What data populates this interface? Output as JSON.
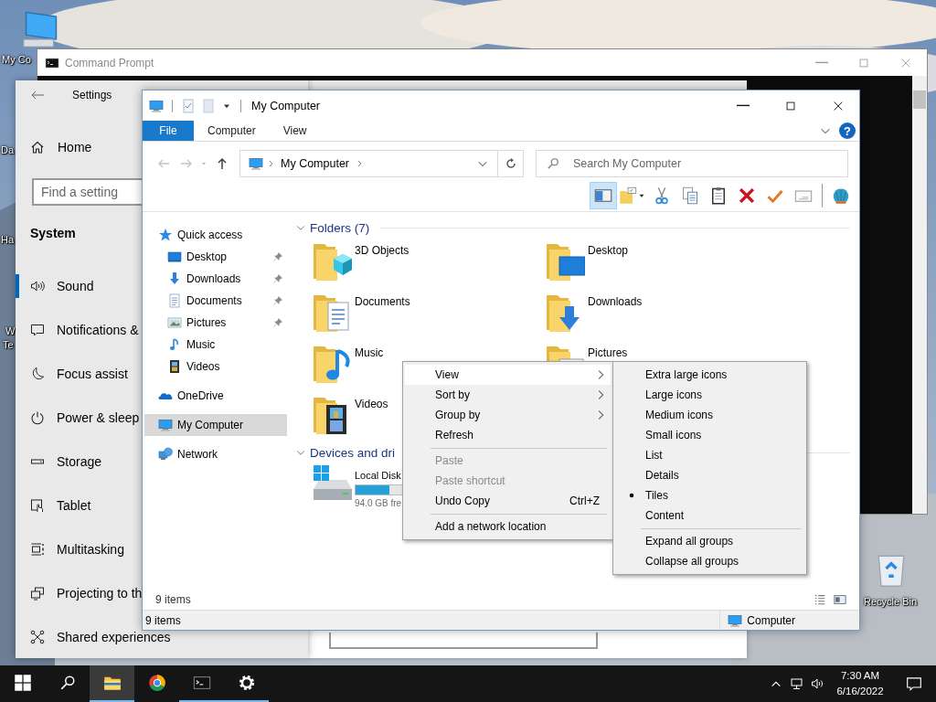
{
  "desktop": {
    "icons": [
      {
        "kind": "computer",
        "label": "My Co"
      },
      {
        "kind": "recycle-bin",
        "label": "Recycle Bin"
      }
    ],
    "labels": [
      "Da",
      "Ha",
      "W",
      "Te"
    ]
  },
  "command_prompt": {
    "title": "Command Prompt"
  },
  "settings": {
    "title": "Settings",
    "home": "Home",
    "search": {
      "placeholder": "Find a setting"
    },
    "section": "System",
    "items": [
      {
        "kind": "sound",
        "label": "Sound",
        "selected": true
      },
      {
        "kind": "notifications",
        "label": "Notifications &",
        "selected": false
      },
      {
        "kind": "focus",
        "label": "Focus assist",
        "selected": false
      },
      {
        "kind": "power",
        "label": "Power & sleep",
        "selected": false
      },
      {
        "kind": "storage",
        "label": "Storage",
        "selected": false
      },
      {
        "kind": "tablet",
        "label": "Tablet",
        "selected": false
      },
      {
        "kind": "multitasking",
        "label": "Multitasking",
        "selected": false
      },
      {
        "kind": "projecting",
        "label": "Projecting to th",
        "selected": false
      },
      {
        "kind": "shared",
        "label": "Shared experiences",
        "selected": false
      }
    ]
  },
  "explorer": {
    "title": "My Computer",
    "ribbon_tabs": [
      {
        "kind": "file-menu",
        "label": "File"
      },
      {
        "kind": "tab",
        "label": "Computer",
        "selected": false
      },
      {
        "kind": "tab",
        "label": "View",
        "selected": false
      }
    ],
    "help": "?",
    "address": {
      "path": "My Computer"
    },
    "search": {
      "placeholder": "Search My Computer"
    },
    "toolbar": [
      {
        "kind": "preview-pane",
        "selected": true
      },
      {
        "kind": "layout",
        "selected": false
      },
      {
        "kind": "cut",
        "selected": false
      },
      {
        "kind": "copy",
        "selected": false
      },
      {
        "kind": "paste",
        "selected": false
      },
      {
        "kind": "delete",
        "selected": false
      },
      {
        "kind": "check",
        "selected": false
      },
      {
        "kind": "rename",
        "selected": false
      },
      {
        "kind": "shell",
        "selected": false
      }
    ],
    "nav": [
      {
        "kind": "quick-access",
        "label": "Quick access",
        "selected": false,
        "children": [
          {
            "kind": "desktop",
            "label": "Desktop",
            "pinned": true,
            "selected": false
          },
          {
            "kind": "downloads",
            "label": "Downloads",
            "pinned": true,
            "selected": false
          },
          {
            "kind": "documents",
            "label": "Documents",
            "pinned": true,
            "selected": false
          },
          {
            "kind": "pictures",
            "label": "Pictures",
            "pinned": true,
            "selected": false
          },
          {
            "kind": "music",
            "label": "Music",
            "pinned": false,
            "selected": false
          },
          {
            "kind": "videos",
            "label": "Videos",
            "pinned": false,
            "selected": false
          }
        ]
      },
      {
        "kind": "onedrive",
        "label": "OneDrive",
        "selected": false
      },
      {
        "kind": "computer",
        "label": "My Computer",
        "selected": true
      },
      {
        "kind": "network",
        "label": "Network",
        "selected": false
      }
    ],
    "groups": [
      {
        "title": "Folders (7)",
        "expanded": true,
        "tiles": [
          {
            "kind": "objects",
            "label": "3D Objects"
          },
          {
            "kind": "desktop",
            "label": "Desktop"
          },
          {
            "kind": "documents",
            "label": "Documents"
          },
          {
            "kind": "downloads",
            "label": "Downloads"
          },
          {
            "kind": "music",
            "label": "Music"
          },
          {
            "kind": "pictures",
            "label": "Pictures"
          },
          {
            "kind": "videos",
            "label": "Videos"
          }
        ]
      },
      {
        "title": "Devices and dri",
        "expanded": true,
        "tiles": [
          {
            "kind": "drive",
            "label": "Local Disk",
            "level": 0.25,
            "detail": "94.0 GB fre"
          }
        ]
      }
    ],
    "item_count": "9 items",
    "status_bar": {
      "count": "9 items",
      "location": "Computer"
    }
  },
  "context_menu": {
    "items": [
      {
        "kind": "item",
        "label": "View",
        "submenu": true,
        "selected": true,
        "disabled": false
      },
      {
        "kind": "item",
        "label": "Sort by",
        "submenu": true,
        "selected": false,
        "disabled": false
      },
      {
        "kind": "item",
        "label": "Group by",
        "submenu": true,
        "selected": false,
        "disabled": false
      },
      {
        "kind": "item",
        "label": "Refresh",
        "submenu": false,
        "selected": false,
        "disabled": false
      },
      {
        "kind": "separator"
      },
      {
        "kind": "item",
        "label": "Paste",
        "submenu": false,
        "selected": false,
        "disabled": true
      },
      {
        "kind": "item",
        "label": "Paste shortcut",
        "submenu": false,
        "selected": false,
        "disabled": true
      },
      {
        "kind": "item",
        "label": "Undo Copy",
        "shortcut": "Ctrl+Z",
        "submenu": false,
        "selected": false,
        "disabled": false
      },
      {
        "kind": "separator"
      },
      {
        "kind": "item",
        "label": "Add a network location",
        "submenu": false,
        "selected": false,
        "disabled": false
      }
    ],
    "submenu": {
      "items": [
        {
          "kind": "item",
          "label": "Extra large icons",
          "selected": false
        },
        {
          "kind": "item",
          "label": "Large icons",
          "selected": false
        },
        {
          "kind": "item",
          "label": "Medium icons",
          "selected": false
        },
        {
          "kind": "item",
          "label": "Small icons",
          "selected": false
        },
        {
          "kind": "item",
          "label": "List",
          "selected": false
        },
        {
          "kind": "item",
          "label": "Details",
          "selected": false
        },
        {
          "kind": "item",
          "label": "Tiles",
          "selected": true
        },
        {
          "kind": "item",
          "label": "Content",
          "selected": false
        },
        {
          "kind": "separator"
        },
        {
          "kind": "item",
          "label": "Expand all groups",
          "selected": false
        },
        {
          "kind": "item",
          "label": "Collapse all groups",
          "selected": false
        }
      ]
    }
  },
  "taskbar": {
    "buttons": [
      {
        "kind": "start",
        "running": false,
        "active": false
      },
      {
        "kind": "search",
        "running": false,
        "active": false
      },
      {
        "kind": "file-explorer",
        "running": true,
        "active": true
      },
      {
        "kind": "browser",
        "running": false,
        "active": false
      },
      {
        "kind": "terminal",
        "running": true,
        "active": false
      },
      {
        "kind": "settings",
        "running": true,
        "active": false
      }
    ],
    "tray": {
      "time": "7:30 AM",
      "date": "6/16/2022"
    }
  }
}
